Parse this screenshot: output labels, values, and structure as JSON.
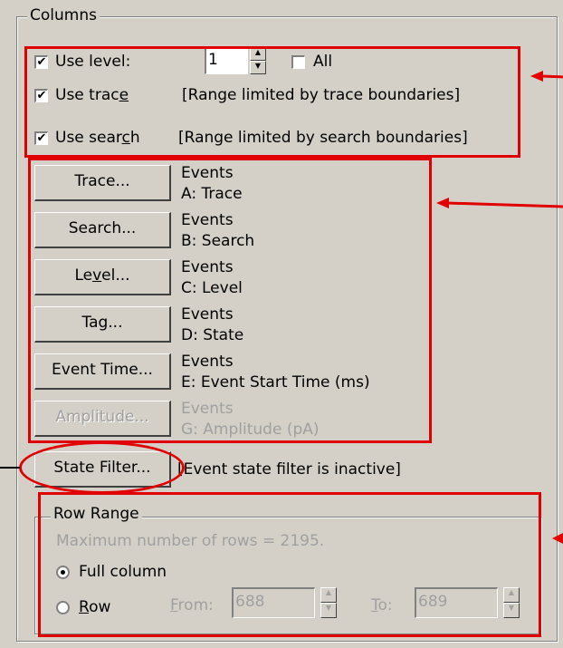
{
  "columns_group": {
    "title": "Columns",
    "use_level": {
      "label": "Use level:",
      "checked": true,
      "value": "1"
    },
    "all": {
      "label": "All",
      "checked": false
    },
    "use_trace": {
      "label_pre": "Use trac",
      "label_u": "e",
      "checked": true,
      "note": "[Range limited by trace boundaries]"
    },
    "use_search": {
      "label_pre": "Use sear",
      "label_u": "c",
      "label_post": "h",
      "checked": true,
      "note": "[Range limited by search boundaries]"
    },
    "buttons": [
      {
        "label": "Trace...",
        "line1": "Events",
        "line2": "A: Trace",
        "enabled": true
      },
      {
        "label": "Search...",
        "line1": "Events",
        "line2": "B: Search",
        "enabled": true
      },
      {
        "label_pre": "Le",
        "label_u": "v",
        "label_post": "el...",
        "line1": "Events",
        "line2": "C: Level",
        "enabled": true
      },
      {
        "label": "Tag...",
        "line1": "Events",
        "line2": "D: State",
        "enabled": true
      },
      {
        "label": "Event Time...",
        "line1": "Events",
        "line2": "E: Event Start Time (ms)",
        "enabled": true
      },
      {
        "label": "Amplitude...",
        "line1": "Events",
        "line2": "G: Amplitude (pA)",
        "enabled": false
      }
    ],
    "state_filter": {
      "label": "State Filter...",
      "note": "[Event state filter is inactive]"
    }
  },
  "row_range": {
    "title": "Row Range",
    "max_rows": "Maximum number of rows = 2195.",
    "full_column": {
      "label": "Full column",
      "selected": true
    },
    "row": {
      "label_u": "R",
      "label_post": "ow",
      "selected": false
    },
    "from": {
      "label_u": "F",
      "label_post": "rom:",
      "value": "688"
    },
    "to": {
      "label_u": "T",
      "label_post": "o:",
      "value": "689"
    }
  },
  "colors": {
    "annotation_red": "#e00000",
    "dialog_bg": "#d4d0c8",
    "disabled_text": "#a0a0a0"
  }
}
